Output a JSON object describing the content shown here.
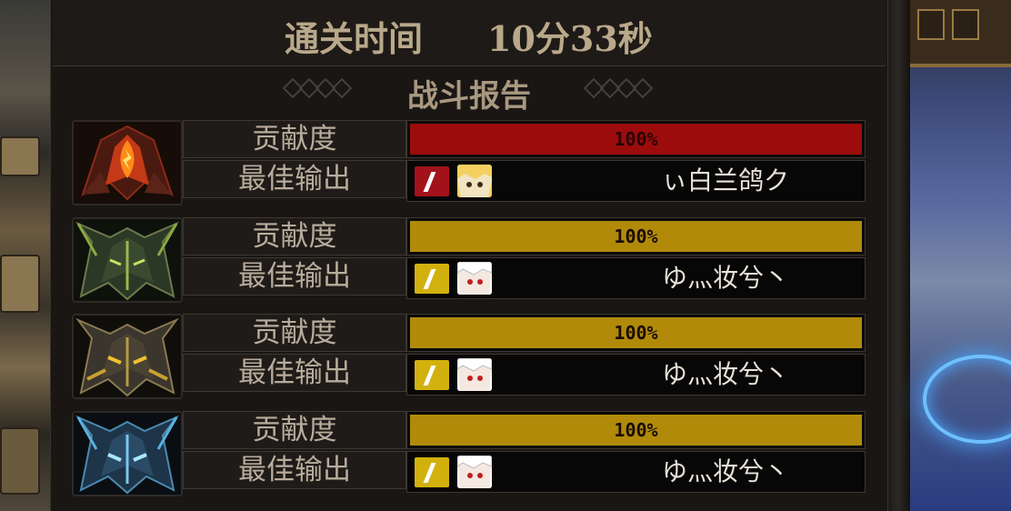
{
  "header": {
    "clear_time_label": "通关时间",
    "clear_time_value": "10分33秒"
  },
  "report": {
    "title": "战斗报告",
    "contribution_label": "贡献度",
    "best_output_label": "最佳输出",
    "players": [
      {
        "avatar_icon": "red-flame-helmet-icon",
        "contribution": "100%",
        "contribution_fraction": 1.0,
        "bar_color": "#9c0c0c",
        "class_icon_color": "#a3121a",
        "char_portrait": "blonde-character-icon",
        "best_output_name": "ぃ白兰鸽ク"
      },
      {
        "avatar_icon": "green-horned-helmet-icon",
        "contribution": "100%",
        "contribution_fraction": 1.0,
        "bar_color": "#b18a0a",
        "class_icon_color": "#d2b10e",
        "char_portrait": "white-hair-character-icon",
        "best_output_name": "ゆ灬妆兮丶"
      },
      {
        "avatar_icon": "gold-horned-helmet-icon",
        "contribution": "100%",
        "contribution_fraction": 1.0,
        "bar_color": "#b18a0a",
        "class_icon_color": "#d2b10e",
        "char_portrait": "white-hair-character-icon",
        "best_output_name": "ゆ灬妆兮丶"
      },
      {
        "avatar_icon": "blue-horned-helmet-icon",
        "contribution": "100%",
        "contribution_fraction": 1.0,
        "bar_color": "#b18a0a",
        "class_icon_color": "#d2b10e",
        "char_portrait": "white-hair-character-icon",
        "best_output_name": "ゆ灬妆兮丶"
      }
    ]
  }
}
